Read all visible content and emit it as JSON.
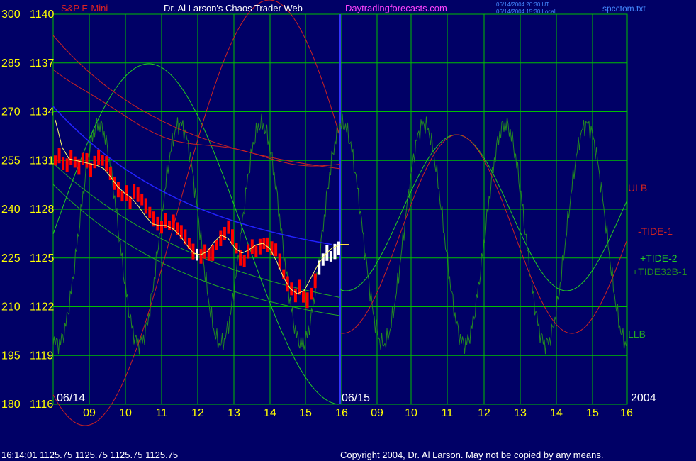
{
  "header": {
    "symbol": "S&P E-Mini",
    "title": "Dr. Al Larson's Chaos Trader Web",
    "site": "Daytradingforecasts.com",
    "ut_time": "06/14/2004 20:30 UT",
    "local_time": "06/14/2004 15:30 Local",
    "filename": "spcctom.txt"
  },
  "footer": {
    "quote": "16:14:01  1125.75 1125.75 1125.75 1125.75",
    "copyright": "Copyright 2004, Dr. Al Larson. May not be copied by any means."
  },
  "colors": {
    "background": "#000066",
    "grid": "#00c000",
    "axis_text": "#ffff00",
    "price_bars": "#ff0000",
    "price_bars_recent": "#ffffff",
    "ma_line": "#ffff66",
    "ulb": "#cc2222",
    "llb": "#22aa22",
    "tide1": "#cc2222",
    "tide2": "#22cc22",
    "tide32": "#228822",
    "blue_line": "#2222ff",
    "divider": "#3333ff"
  },
  "chart_data": {
    "type": "line",
    "title": "Dr. Al Larson's Chaos Trader Web",
    "y_left_labels": [
      "300",
      "285",
      "270",
      "255",
      "240",
      "225",
      "210",
      "195",
      "180"
    ],
    "y_price_labels": [
      "1140",
      "1137",
      "1134",
      "1131",
      "1128",
      "1125",
      "1122",
      "1119",
      "1116"
    ],
    "y_price_range": [
      1116,
      1140
    ],
    "y_oscillator_range": [
      180,
      300
    ],
    "x_labels": [
      "09",
      "10",
      "11",
      "12",
      "13",
      "14",
      "15",
      "16",
      "09",
      "10",
      "11",
      "12",
      "13",
      "14",
      "15",
      "16"
    ],
    "date_labels": {
      "day1": "06/14",
      "day2": "06/15",
      "year": "2004"
    },
    "series_labels": {
      "ulb": "ULB",
      "tide1": "-TIDE-1",
      "tide2": "+TIDE-2",
      "tide32": "+TIDE32B-1",
      "llb": "LLB"
    },
    "grid": true,
    "price_bars": [
      1131.0,
      1131.3,
      1130.8,
      1130.7,
      1131.2,
      1130.9,
      1130.6,
      1131.1,
      1131.0,
      1130.4,
      1130.9,
      1131.2,
      1131.0,
      1130.8,
      1130.2,
      1129.6,
      1129.2,
      1128.8,
      1129.0,
      1128.4,
      1129.1,
      1128.9,
      1128.6,
      1128.2,
      1127.8,
      1127.4,
      1127.1,
      1126.9,
      1127.3,
      1127.0,
      1127.2,
      1126.8,
      1126.6,
      1126.3,
      1125.9,
      1125.4,
      1125.2,
      1125.1,
      1125.4,
      1125.2,
      1125.3,
      1125.8,
      1126.2,
      1126.5,
      1126.9,
      1126.3,
      1125.6,
      1125.0,
      1124.8,
      1125.4,
      1125.7,
      1125.4,
      1125.7,
      1125.9,
      1125.8,
      1125.6,
      1125.5,
      1124.8,
      1124.0,
      1123.4,
      1123.1,
      1122.7,
      1123.2,
      1122.6,
      1122.4,
      1122.8,
      1123.6,
      1124.4,
      1124.9,
      1125.3,
      1125.1,
      1125.4,
      1125.6
    ],
    "ma_line": [
      1133.5,
      1131.8,
      1131.1,
      1131.0,
      1130.9,
      1130.8,
      1130.7,
      1130.5,
      1130.0,
      1129.4,
      1129.0,
      1128.7,
      1128.2,
      1127.6,
      1127.1,
      1127.0,
      1127.0,
      1126.8,
      1126.4,
      1125.8,
      1125.3,
      1125.2,
      1125.4,
      1126.0,
      1126.4,
      1126.2,
      1125.6,
      1125.3,
      1125.5,
      1125.8,
      1125.9,
      1125.6,
      1124.8,
      1123.8,
      1123.1,
      1122.8,
      1123.0,
      1123.8,
      1124.6,
      1125.2,
      1125.6,
      1125.8
    ]
  }
}
